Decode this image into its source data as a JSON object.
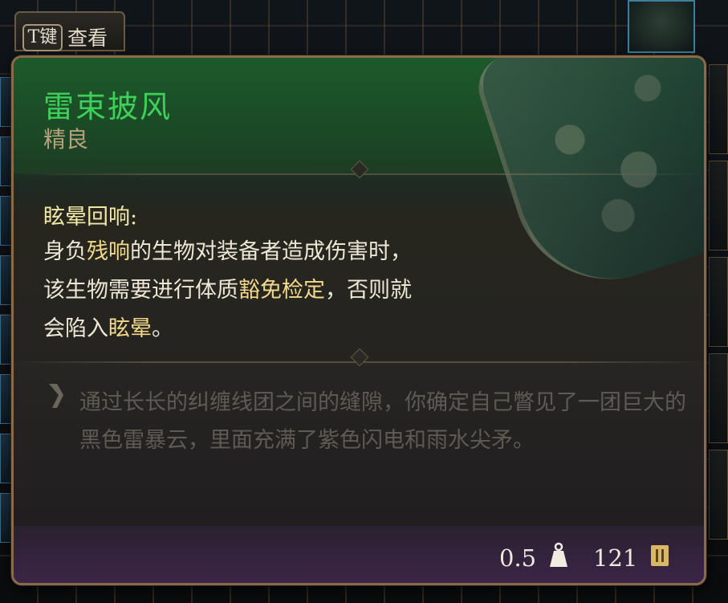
{
  "key_hint": {
    "key": "T键",
    "label": "查看"
  },
  "item": {
    "name": "雷束披风",
    "rarity": "精良",
    "passive": {
      "name": "眩晕回响:",
      "line1": {
        "a": "身负",
        "hl1": "残响",
        "b": "的生物对装备者造成伤害时，"
      },
      "line2": {
        "a": "该生物需要进行体质",
        "hl1": "豁免检定",
        "b": "，否则就"
      },
      "line3": {
        "a": "会陷入",
        "hl1": "眩晕",
        "b": "。"
      }
    },
    "flavor": "通过长长的纠缠线团之间的缝隙，你确定自己瞥见了一团巨大的黑色雷暴云，里面充满了紫色闪电和雨水尖矛。",
    "weight": "0.5",
    "price": "121"
  },
  "colors": {
    "title": "#3ed15a",
    "rarity": "#b5a27a",
    "highlight": "#f3d98a",
    "flavor": "#5f5a52",
    "border": "#8b6a4a"
  },
  "icons": {
    "quote": "quote-mark-icon",
    "weight": "weight-icon",
    "price": "gold-coin-icon"
  }
}
